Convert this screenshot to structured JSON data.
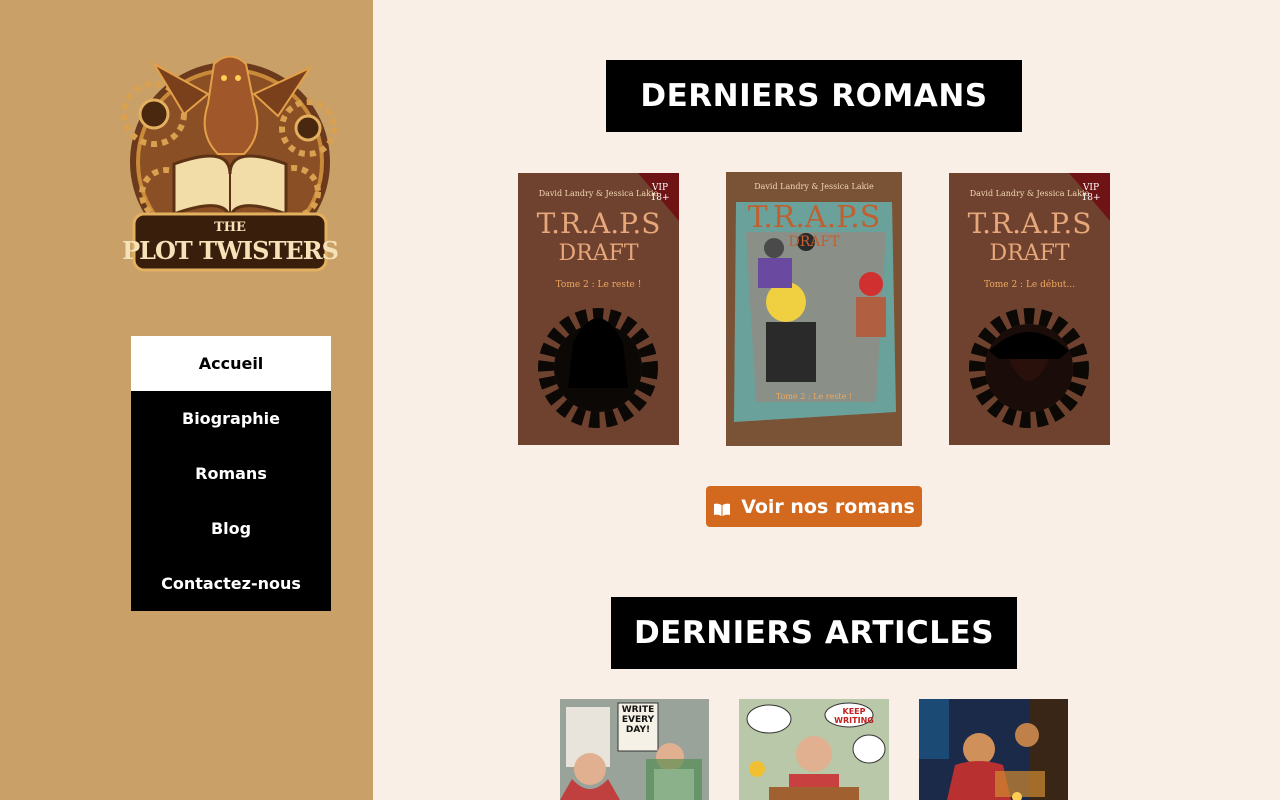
{
  "sidebar": {
    "logo": {
      "top": "THE",
      "main": "PLOT TWISTERS"
    },
    "nav": [
      {
        "label": "Accueil",
        "active": true
      },
      {
        "label": "Biographie",
        "active": false
      },
      {
        "label": "Romans",
        "active": false
      },
      {
        "label": "Blog",
        "active": false
      },
      {
        "label": "Contactez-nous",
        "active": false
      }
    ]
  },
  "main": {
    "romans_title": "DERNIERS ROMANS",
    "books": [
      {
        "authors": "David Landry & Jessica Lakie",
        "title": "T.R.A.P.S",
        "subtitle": "DRAFT",
        "tome": "Tome 2 : Le reste !",
        "badge": "VIP 18+"
      },
      {
        "authors": "David Landry & Jessica Lakie",
        "title": "T.R.A.P.S",
        "subtitle": "DRAFT",
        "tome": "Tome 2 : Le reste !",
        "badge": ""
      },
      {
        "authors": "David Landry & Jessica Lakie",
        "title": "T.R.A.P.S",
        "subtitle": "DRAFT",
        "tome": "Tome 2 : Le début...",
        "badge": "VIP 18+"
      }
    ],
    "romans_button": "Voir nos romans",
    "articles_title": "DERNIERS ARTICLES",
    "articles": [
      {
        "caption": "WRITE EVERY DAY!"
      },
      {
        "caption": "KEEP WRITING"
      },
      {
        "caption": ""
      }
    ]
  },
  "colors": {
    "sidebar_bg": "#c9a068",
    "page_bg": "#faefe6",
    "accent": "#d2691e",
    "nav_bg": "#000000"
  }
}
